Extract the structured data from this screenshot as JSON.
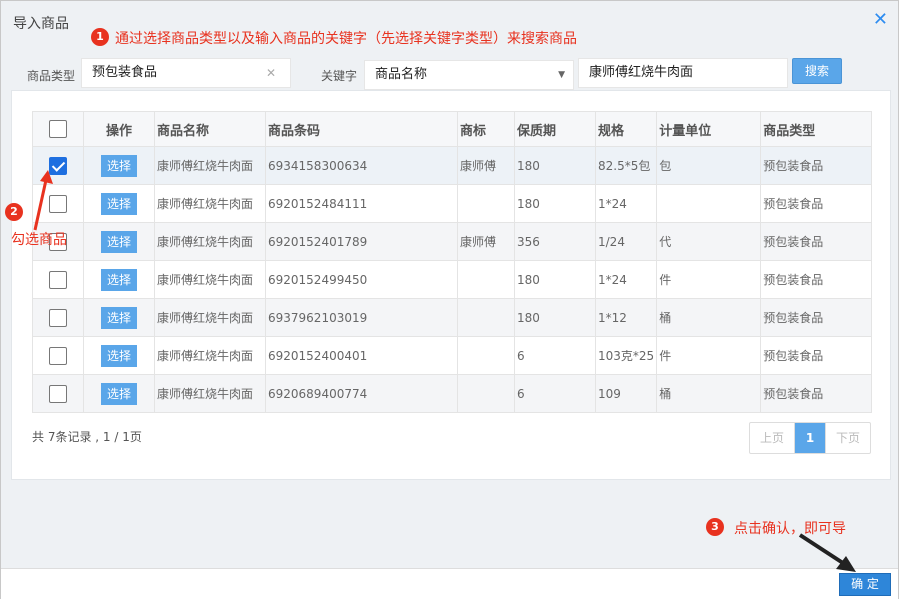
{
  "dialog": {
    "title": "导入商品",
    "close_glyph": "✕"
  },
  "annotations": {
    "a1": {
      "num": "1",
      "text": "通过选择商品类型以及输入商品的关键字（先选择关键字类型）来搜索商品"
    },
    "a2": {
      "num": "2",
      "text": "勾选商品"
    },
    "a3": {
      "num": "3",
      "text": "点击确认，即可导"
    },
    "color": "#e8321f"
  },
  "filters": {
    "type_label": "商品类型",
    "type_value": "预包装食品",
    "clear_glyph": "✕",
    "keyword_label": "关键字",
    "keyword_type_value": "商品名称",
    "dropdown_glyph": "▼",
    "keyword_value": "康师傅红烧牛肉面",
    "search_label": "搜索"
  },
  "table": {
    "headers": [
      "操作",
      "商品名称",
      "商品条码",
      "商标",
      "保质期",
      "规格",
      "计量单位",
      "商品类型"
    ],
    "select_label": "选择",
    "rows": [
      {
        "checked": true,
        "name": "康师傅红烧牛肉面",
        "barcode": "6934158300634",
        "brand": "康师傅",
        "shelf": "180",
        "spec": "82.5*5包",
        "unit": "包",
        "type": "预包装食品"
      },
      {
        "checked": false,
        "name": "康师傅红烧牛肉面",
        "barcode": "6920152484111",
        "brand": "",
        "shelf": "180",
        "spec": "1*24",
        "unit": "",
        "type": "预包装食品"
      },
      {
        "checked": false,
        "name": "康师傅红烧牛肉面",
        "barcode": "6920152401789",
        "brand": "康师傅",
        "shelf": "356",
        "spec": "1/24",
        "unit": "代",
        "type": "预包装食品"
      },
      {
        "checked": false,
        "name": "康师傅红烧牛肉面",
        "barcode": "6920152499450",
        "brand": "",
        "shelf": "180",
        "spec": "1*24",
        "unit": "件",
        "type": "预包装食品"
      },
      {
        "checked": false,
        "name": "康师傅红烧牛肉面",
        "barcode": "6937962103019",
        "brand": "",
        "shelf": "180",
        "spec": "1*12",
        "unit": "桶",
        "type": "预包装食品"
      },
      {
        "checked": false,
        "name": "康师傅红烧牛肉面",
        "barcode": "6920152400401",
        "brand": "",
        "shelf": "6",
        "spec": "103克*25",
        "unit": "件",
        "type": "预包装食品"
      },
      {
        "checked": false,
        "name": "康师傅红烧牛肉面",
        "barcode": "6920689400774",
        "brand": "",
        "shelf": "6",
        "spec": "109",
        "unit": "桶",
        "type": "预包装食品"
      }
    ]
  },
  "pagination": {
    "summary": "共 7条记录 , 1 / 1页",
    "prev": "上页",
    "current": "1",
    "next": "下页"
  },
  "footer": {
    "confirm_label": "确 定"
  }
}
